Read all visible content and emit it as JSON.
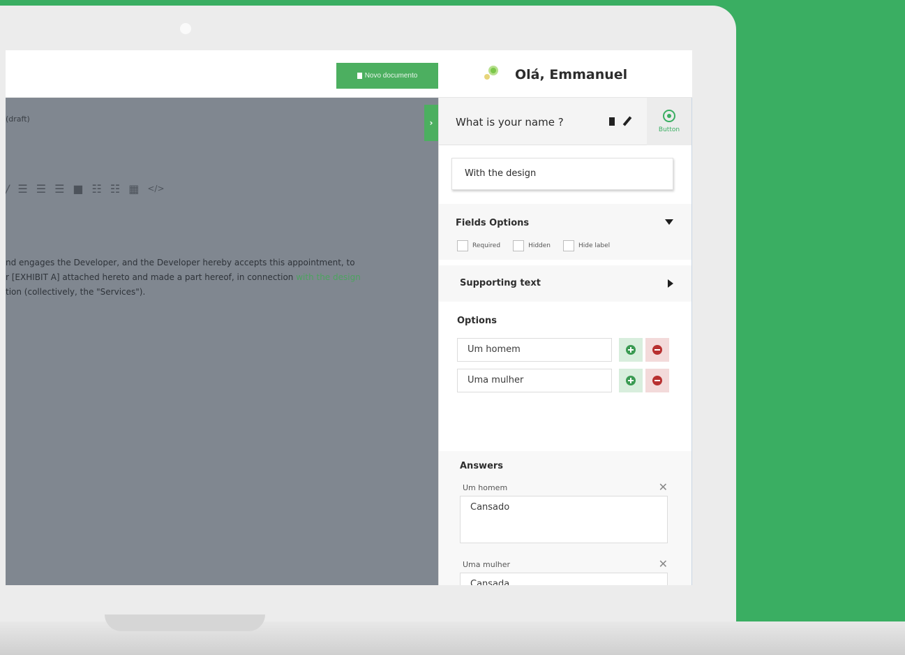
{
  "header": {
    "new_doc_label": "Novo documento",
    "greeting": "Olá, Emmanuel"
  },
  "editor": {
    "draft_label": "(draft)",
    "collapse_label": "›",
    "text_line1": "nd engages the Developer, and the Developer hereby accepts this appointment, to",
    "text_line2_a": "r [EXHIBIT A] attached hereto and made a part hereof, in connection ",
    "text_line2_b": "with the design",
    "text_line3": "tion (collectively, the \"Services\")."
  },
  "panel": {
    "question_title": "What is your name ?",
    "button_tab_label": "Button",
    "design_value": "With the design",
    "fields_options": {
      "title": "Fields Options",
      "checks": [
        "Required",
        "Hidden",
        "Hide label"
      ]
    },
    "supporting_text": {
      "title": "Supporting text"
    },
    "options": {
      "title": "Options",
      "items": [
        "Um homem",
        "Uma mulher"
      ]
    },
    "answers": {
      "title": "Answers",
      "items": [
        {
          "label": "Um homem",
          "value": "Cansado"
        },
        {
          "label": "Uma mulher",
          "value": "Cansada"
        }
      ],
      "close_glyph": "✕"
    }
  },
  "colors": {
    "background_green": "#3aae62",
    "accent_green": "#4caf60",
    "remove_red": "#b83030"
  }
}
